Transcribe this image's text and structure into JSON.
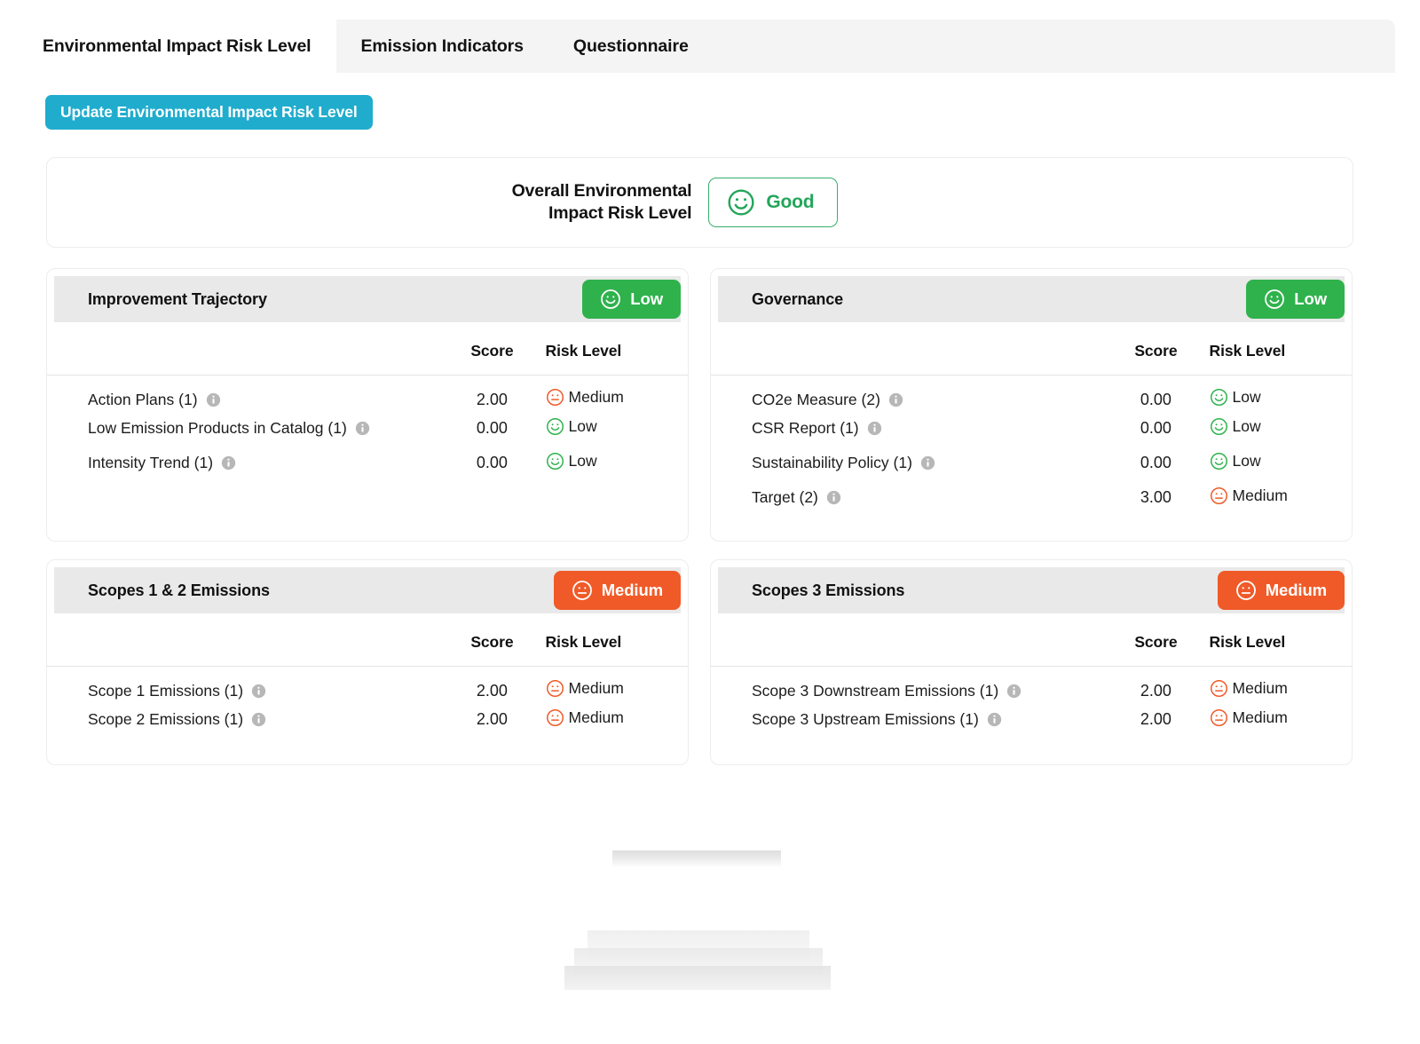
{
  "tabs": [
    {
      "label": "Environmental Impact Risk Level",
      "active": true
    },
    {
      "label": "Emission Indicators",
      "active": false
    },
    {
      "label": "Questionnaire",
      "active": false
    }
  ],
  "toolbar": {
    "update_button_label": "Update Environmental Impact Risk Level"
  },
  "overall": {
    "label": "Overall Environmental\nImpact Risk Level",
    "badge_text": "Good",
    "badge_icon": "smiley-face-icon"
  },
  "columns": {
    "score": "Score",
    "risk_level": "Risk Level"
  },
  "colors": {
    "accent_button": "#20ACCD",
    "low_green": "#2FB24C",
    "medium_orange": "#F05A28",
    "good_green": "#23A55A",
    "header_grey": "#e9e9e9",
    "tabbar_grey": "#f4f4f4",
    "info_grey": "#b7b7b7"
  },
  "cards": [
    {
      "title": "Improvement Trajectory",
      "badge": {
        "text": "Low",
        "level": "low",
        "icon": "smiley-face-icon"
      },
      "rows": [
        {
          "name": "Action Plans (1)",
          "score": "2.00",
          "risk": "Medium",
          "level": "medium",
          "icon": "neutral-face-icon",
          "info": "info-icon"
        },
        {
          "name": "Low Emission Products in Catalog (1)",
          "score": "0.00",
          "risk": "Low",
          "level": "low",
          "icon": "smiley-face-icon",
          "info": "info-icon"
        },
        {
          "name": "Intensity Trend (1)",
          "score": "0.00",
          "risk": "Low",
          "level": "low",
          "icon": "smiley-face-icon",
          "info": "info-icon"
        }
      ]
    },
    {
      "title": "Governance",
      "badge": {
        "text": "Low",
        "level": "low",
        "icon": "smiley-face-icon"
      },
      "rows": [
        {
          "name": "CO2e Measure (2)",
          "score": "0.00",
          "risk": "Low",
          "level": "low",
          "icon": "smiley-face-icon",
          "info": "info-icon"
        },
        {
          "name": "CSR Report (1)",
          "score": "0.00",
          "risk": "Low",
          "level": "low",
          "icon": "smiley-face-icon",
          "info": "info-icon"
        },
        {
          "name": "Sustainability Policy (1)",
          "score": "0.00",
          "risk": "Low",
          "level": "low",
          "icon": "smiley-face-icon",
          "info": "info-icon"
        },
        {
          "name": "Target (2)",
          "score": "3.00",
          "risk": "Medium",
          "level": "medium",
          "icon": "neutral-face-icon",
          "info": "info-icon"
        }
      ]
    },
    {
      "title": "Scopes 1 & 2 Emissions",
      "badge": {
        "text": "Medium",
        "level": "medium",
        "icon": "neutral-face-icon"
      },
      "rows": [
        {
          "name": "Scope 1 Emissions (1)",
          "score": "2.00",
          "risk": "Medium",
          "level": "medium",
          "icon": "neutral-face-icon",
          "info": "info-icon"
        },
        {
          "name": "Scope 2 Emissions (1)",
          "score": "2.00",
          "risk": "Medium",
          "level": "medium",
          "icon": "neutral-face-icon",
          "info": "info-icon"
        }
      ]
    },
    {
      "title": "Scopes 3 Emissions",
      "badge": {
        "text": "Medium",
        "level": "medium",
        "icon": "neutral-face-icon"
      },
      "rows": [
        {
          "name": "Scope 3 Downstream Emissions (1)",
          "score": "2.00",
          "risk": "Medium",
          "level": "medium",
          "icon": "neutral-face-icon",
          "info": "info-icon"
        },
        {
          "name": "Scope 3 Upstream Emissions (1)",
          "score": "2.00",
          "risk": "Medium",
          "level": "medium",
          "icon": "neutral-face-icon",
          "info": "info-icon"
        }
      ]
    }
  ]
}
